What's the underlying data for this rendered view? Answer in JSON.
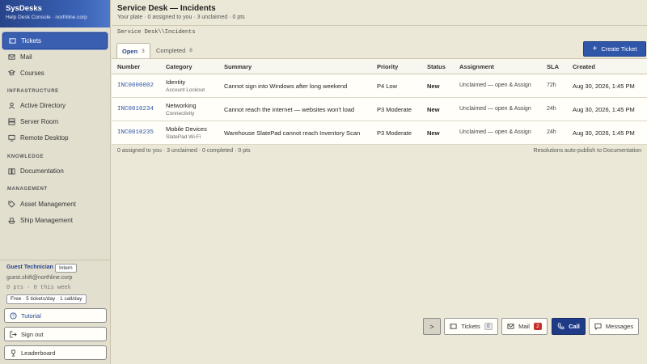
{
  "app": {
    "title": "SysDesks",
    "subtitle": "Help Desk Console · northline.corp"
  },
  "sidebar": {
    "nav": [
      {
        "label": "Tickets",
        "icon": "ticket-icon",
        "active": true
      },
      {
        "label": "Mail",
        "icon": "mail-icon"
      },
      {
        "label": "Courses",
        "icon": "courses-icon"
      }
    ],
    "sections": [
      {
        "title": "INFRASTRUCTURE",
        "items": [
          {
            "label": "Active Directory",
            "icon": "user-icon"
          },
          {
            "label": "Server Room",
            "icon": "server-icon"
          },
          {
            "label": "Remote Desktop",
            "icon": "monitor-icon"
          }
        ]
      },
      {
        "title": "KNOWLEDGE",
        "items": [
          {
            "label": "Documentation",
            "icon": "book-icon"
          }
        ]
      },
      {
        "title": "MANAGEMENT",
        "items": [
          {
            "label": "Asset Management",
            "icon": "tag-icon"
          },
          {
            "label": "Ship Management",
            "icon": "ship-icon"
          }
        ]
      }
    ],
    "user": {
      "name": "Guest Technician",
      "role_badge": "Intern",
      "email": "guest.shift@northline.corp",
      "points": "0 pts · 0 this week",
      "plan": "Free · 5 tickets/day · 1 call/day"
    },
    "buttons": {
      "tutorial": "Tutorial",
      "sign_out": "Sign out",
      "leaderboard": "Leaderboard"
    }
  },
  "header": {
    "title": "Service Desk — Incidents",
    "subtitle": "Your plate · 0 assigned to you · 3 unclaimed · 0 pts",
    "breadcrumb": "Service Desk\\\\Incidents"
  },
  "tabs": [
    {
      "label": "Open",
      "count": "3",
      "active": true
    },
    {
      "label": "Completed",
      "count": "8",
      "active": false
    }
  ],
  "create_button": "Create Ticket",
  "table": {
    "columns": [
      "Number",
      "Category",
      "Summary",
      "Priority",
      "Status",
      "Assignment",
      "SLA",
      "Created"
    ],
    "rows": [
      {
        "number": "INC0000002",
        "category": "Identity",
        "subcategory": "Account Lockout",
        "summary": "Cannot sign into Windows after long weekend",
        "priority": "P4 Low",
        "status": "New",
        "assignment": "Unclaimed — open & Assign",
        "sla": "72h",
        "created": "Aug 30, 2026, 1:45 PM"
      },
      {
        "number": "INC0010234",
        "category": "Networking",
        "subcategory": "Connectivity",
        "summary": "Cannot reach the internet — websites won't load",
        "priority": "P3 Moderate",
        "status": "New",
        "assignment": "Unclaimed — open & Assign",
        "sla": "24h",
        "created": "Aug 30, 2026, 1:45 PM"
      },
      {
        "number": "INC0010235",
        "category": "Mobile Devices",
        "subcategory": "SlatePad Wi-Fi",
        "summary": "Warehouse SlatePad cannot reach Inventory Scan",
        "priority": "P3 Moderate",
        "status": "New",
        "assignment": "Unclaimed — open & Assign",
        "sla": "24h",
        "created": "Aug 30, 2026, 1:45 PM"
      }
    ],
    "footer_left": "0 assigned to you · 3 unclaimed · 0 completed · 0 pts",
    "footer_right": "Resolutions auto-publish to Documentation"
  },
  "dock": {
    "toggle": ">",
    "tickets": {
      "label": "Tickets",
      "count": "0"
    },
    "mail": {
      "label": "Mail",
      "count": "2"
    },
    "call": {
      "label": "Call"
    },
    "messages": {
      "label": "Messages"
    }
  },
  "colors": {
    "accent": "#2f56a8",
    "sidebar_bg": "#e3dfcf",
    "main_bg": "#ece8d7",
    "mail_badge": "#c8302b"
  }
}
